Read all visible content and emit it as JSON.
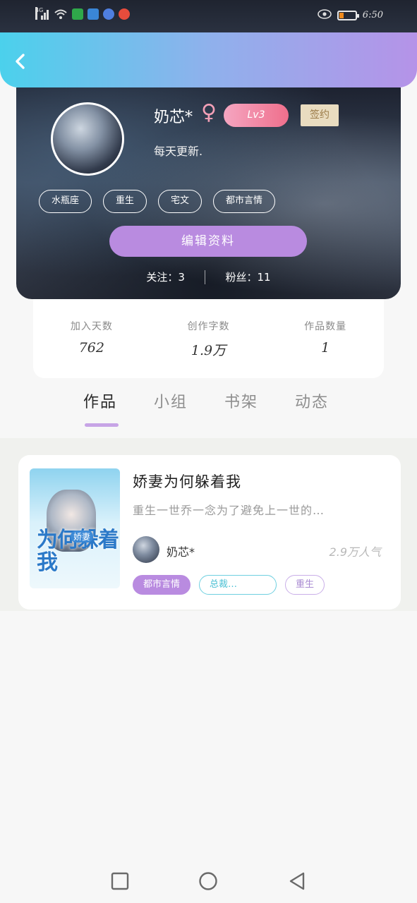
{
  "status_bar": {
    "network": "4G",
    "time": "6:50"
  },
  "profile": {
    "name": "奶芯*",
    "gender_symbol": "♀",
    "level": "Lv3",
    "badge": "签约",
    "bio": "每天更新.",
    "tags": [
      "水瓶座",
      "重生",
      "宅文",
      "都市言情"
    ],
    "edit_label": "编辑资料",
    "following_label": "关注：",
    "following_count": "3",
    "followers_label": "粉丝：",
    "followers_count": "11"
  },
  "stats": [
    {
      "label": "加入天数",
      "value": "762"
    },
    {
      "label": "创作字数",
      "value": "1.9万"
    },
    {
      "label": "作品数量",
      "value": "1"
    }
  ],
  "tabs": [
    {
      "label": "作品",
      "active": true
    },
    {
      "label": "小组",
      "active": false
    },
    {
      "label": "书架",
      "active": false
    },
    {
      "label": "动态",
      "active": false
    }
  ],
  "book": {
    "title": "娇妻为何躲着我",
    "description": "重生一世乔一念为了避免上一世的…",
    "author": "奶芯*",
    "popularity": "2.9万人气",
    "tags": [
      "都市言情",
      "总裁…",
      "重生"
    ],
    "cover_title": "为何躲着我",
    "cover_sub": "娇妻"
  },
  "colors": {
    "header_start": "#4bd1ec",
    "header_end": "#b593e8",
    "accent_purple": "#b98be0",
    "level_pink": "#ef6f8c"
  },
  "icons": {
    "back": "chevron-left-icon",
    "gender": "female-icon",
    "nav_home": "square-icon",
    "nav_circle": "circle-icon",
    "nav_back": "triangle-back-icon"
  }
}
